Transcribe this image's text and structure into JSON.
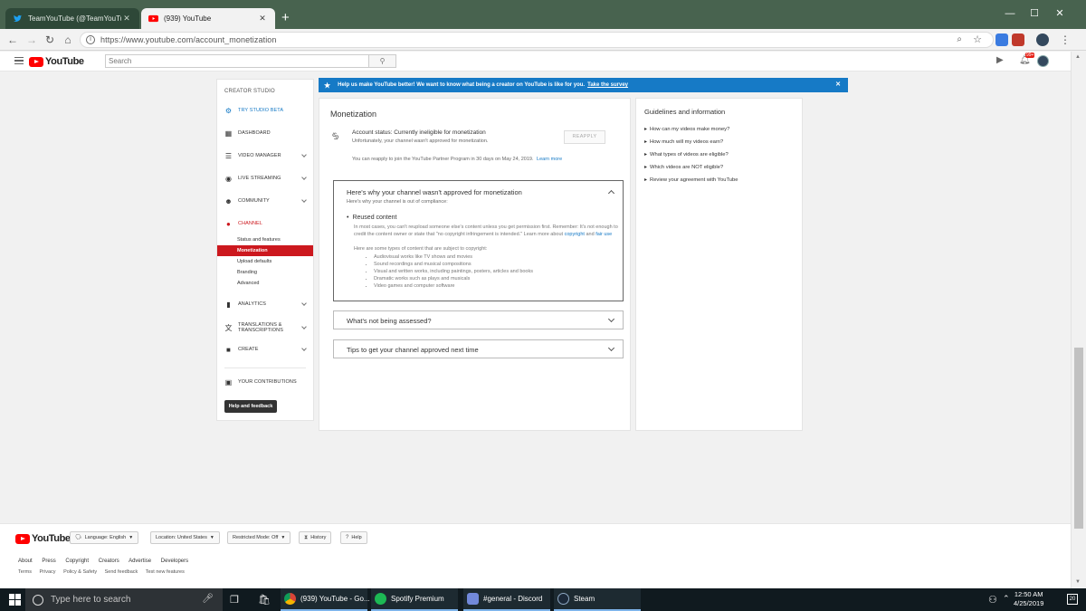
{
  "browser": {
    "tabs": [
      {
        "label": "TeamYouTube (@TeamYouTube) | ...",
        "close": "✕"
      },
      {
        "label": "(939) YouTube",
        "close": "✕"
      }
    ],
    "new_tab": "+",
    "window_controls": {
      "minimize": "—",
      "maximize": "☐",
      "close": "✕"
    },
    "url": "https://www.youtube.com/account_monetization"
  },
  "header": {
    "logo_text": "YouTube",
    "search_placeholder": "Search",
    "bell_badge": "99+"
  },
  "sidebar": {
    "title": "CREATOR STUDIO",
    "try_beta": "TRY STUDIO BETA",
    "dashboard": "DASHBOARD",
    "video_manager": "VIDEO MANAGER",
    "live_streaming": "LIVE STREAMING",
    "community": "COMMUNITY",
    "channel": "CHANNEL",
    "channel_sub": [
      "Status and features",
      "Monetization",
      "Upload defaults",
      "Branding",
      "Advanced"
    ],
    "analytics": "ANALYTICS",
    "translations_line1": "TRANSLATIONS &",
    "translations_line2": "TRANSCRIPTIONS",
    "create": "CREATE",
    "contributions": "YOUR CONTRIBUTIONS",
    "help": "Help and feedback"
  },
  "banner": {
    "text": "Help us make YouTube better! We want to know what being a creator on YouTube is like for you.",
    "link": "Take the survey",
    "close": "✕"
  },
  "monetization": {
    "title": "Monetization",
    "status_title": "Account status: Currently ineligible for monetization",
    "status_desc": "Unfortunately, your channel wasn't approved for monetization.",
    "reapply": "REAPPLY",
    "reapply_note": "You can reapply to join the YouTube Partner Program in 30 days on May 24, 2019.",
    "learn_more": "Learn more",
    "accordion1": {
      "heading": "Here's why your channel wasn't approved for monetization",
      "sub": "Here's why your channel is out of compliance:",
      "bullet": "Reused content",
      "body": "In most cases, you can't reupload someone else's content unless you get permission first. Remember: It's not enough to credit the content owner or state that \"no copyright infringement is intended.\" Learn more about",
      "link_copyright": "copyright",
      "and": "and",
      "link_fairuse": "fair use",
      "list_intro": "Here are some types of content that are subject to copyright:",
      "list": [
        "Audiovisual works like TV shows and movies",
        "Sound recordings and musical compositions",
        "Visual and written works, including paintings, posters, articles and books",
        "Dramatic works such as plays and musicals",
        "Video games and computer software"
      ]
    },
    "accordion2": "What's not being assessed?",
    "accordion3": "Tips to get your channel approved next time"
  },
  "guidelines": {
    "title": "Guidelines and information",
    "items": [
      "How can my videos make money?",
      "How much will my videos earn?",
      "What types of videos are eligible?",
      "Which videos are NOT eligible?",
      "Review your agreement with YouTube"
    ]
  },
  "footer": {
    "logo_text": "YouTube",
    "language": "Language: English",
    "location": "Location: United States",
    "restricted": "Restricted Mode: Off",
    "history": "History",
    "help": "Help",
    "links1": [
      "About",
      "Press",
      "Copyright",
      "Creators",
      "Advertise",
      "Developers"
    ],
    "links2": [
      "Terms",
      "Privacy",
      "Policy & Safety",
      "Send feedback",
      "Test new features"
    ]
  },
  "taskbar": {
    "search_placeholder": "Type here to search",
    "apps": [
      {
        "label": "(939) YouTube - Go..."
      },
      {
        "label": "Spotify Premium"
      },
      {
        "label": "#general - Discord"
      },
      {
        "label": "Steam"
      }
    ],
    "time": "12:50 AM",
    "date": "4/25/2019",
    "notifications": "20"
  },
  "colors": {
    "youtube_red": "#ff0000",
    "studio_red": "#cc181e",
    "link_blue": "#167ac6",
    "titlebar_green": "#48634f",
    "taskbar": "#101a1f"
  }
}
